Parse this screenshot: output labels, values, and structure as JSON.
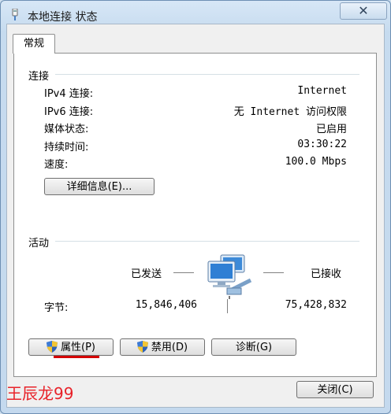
{
  "window": {
    "title": "本地连接 状态",
    "close_glyph": "✕"
  },
  "tab": {
    "label": "常规"
  },
  "connection": {
    "heading": "连接",
    "rows": [
      {
        "label": "IPv4 连接:",
        "value": "Internet"
      },
      {
        "label": "IPv6 连接:",
        "value": "无 Internet 访问权限"
      },
      {
        "label": "媒体状态:",
        "value": "已启用"
      },
      {
        "label": "持续时间:",
        "value": "03:30:22"
      },
      {
        "label": "速度:",
        "value": "100.0 Mbps"
      }
    ],
    "details_button": "详细信息(E)..."
  },
  "activity": {
    "heading": "活动",
    "sent_label": "已发送",
    "received_label": "已接收",
    "bytes_label": "字节:",
    "bytes_sent": "15,846,406",
    "bytes_received": "75,428,832"
  },
  "buttons": {
    "properties": "属性(P)",
    "disable": "禁用(D)",
    "diagnose": "诊断(G)",
    "close": "关闭(C)"
  },
  "watermark": {
    "text": "王辰龙99"
  }
}
